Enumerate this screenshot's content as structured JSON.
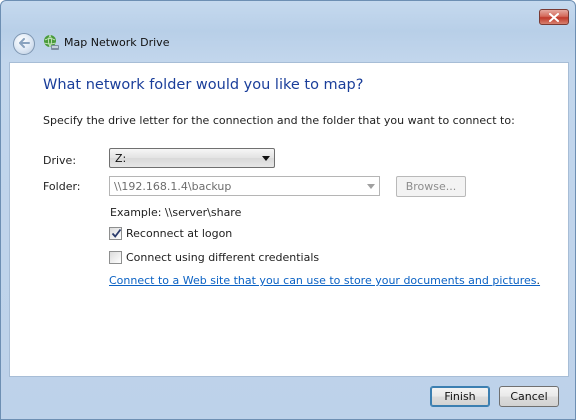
{
  "window": {
    "title": "Map Network Drive",
    "icons": {
      "close": "close-icon",
      "back": "back-arrow-icon",
      "wizard": "network-drive-icon"
    }
  },
  "main": {
    "heading": "What network folder would you like to map?",
    "description": "Specify the drive letter for the connection and the folder that you want to connect to:",
    "drive_label": "Drive:",
    "drive_value": "Z:",
    "folder_label": "Folder:",
    "folder_value": "\\\\192.168.1.4\\backup",
    "browse_label": "Browse...",
    "example": "Example: \\\\server\\share",
    "reconnect_label": "Reconnect at logon",
    "reconnect_checked": true,
    "credentials_label": "Connect using different credentials",
    "credentials_checked": false,
    "web_link": "Connect to a Web site that you can use to store your documents and pictures",
    "web_link_suffix": "."
  },
  "footer": {
    "finish_label": "Finish",
    "cancel_label": "Cancel"
  },
  "colors": {
    "heading": "#1a3e9a",
    "link": "#0b62c4",
    "frame": "#bdd2ea",
    "close_button": "#c0392b"
  }
}
